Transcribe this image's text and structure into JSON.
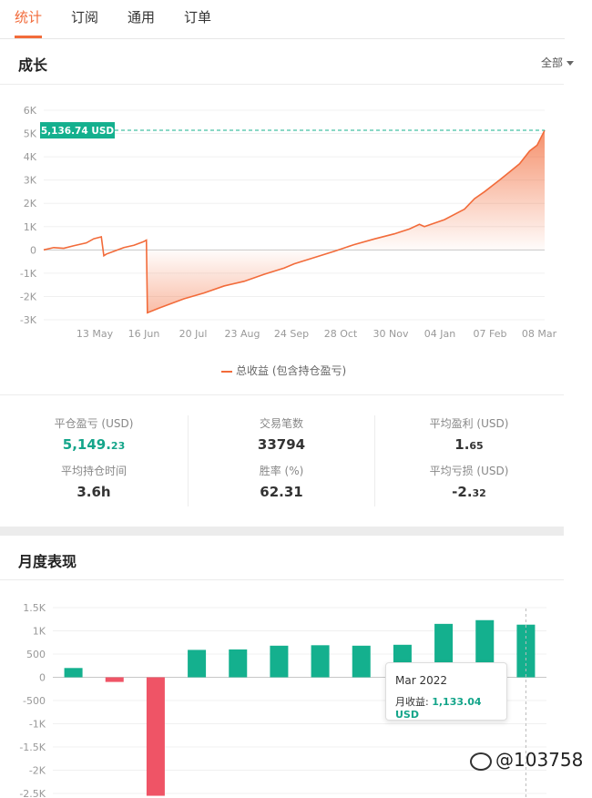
{
  "tabs": [
    {
      "label": "统计",
      "active": true
    },
    {
      "label": "订阅",
      "active": false
    },
    {
      "label": "通用",
      "active": false
    },
    {
      "label": "订单",
      "active": false
    }
  ],
  "growth": {
    "title": "成长",
    "filter": "全部",
    "current_value_label": "5,136.74 USD",
    "legend_label": "总收益 (包含持仓盈亏)"
  },
  "stats": {
    "closed_pnl_label": "平仓盈亏 (USD)",
    "closed_pnl_main": "5,149.",
    "closed_pnl_dec": "23",
    "trades_label": "交易笔数",
    "trades_value": "33794",
    "avg_profit_label": "平均盈利 (USD)",
    "avg_profit_main": "1.",
    "avg_profit_dec": "65",
    "avg_hold_label": "平均持仓时间",
    "avg_hold_value": "3.6h",
    "winrate_label": "胜率 (%)",
    "winrate_value": "62.31",
    "avg_loss_label": "平均亏损 (USD)",
    "avg_loss_main": "-2.",
    "avg_loss_dec": "32"
  },
  "monthly": {
    "title": "月度表现",
    "tooltip_month": "Mar 2022",
    "tooltip_label": "月收益:",
    "tooltip_value": "1,133.04 USD"
  },
  "watermark": "@103758",
  "colors": {
    "accent": "#f26b3a",
    "positive": "#14b08e",
    "negative": "#ef5466"
  },
  "chart_data": [
    {
      "type": "area",
      "title": "成长",
      "series": [
        {
          "name": "总收益 (包含持仓盈亏)"
        }
      ],
      "x_ticks": [
        "13 May",
        "16 Jun",
        "20 Jul",
        "23 Aug",
        "24 Sep",
        "28 Oct",
        "30 Nov",
        "04 Jan",
        "07 Feb",
        "08 Mar"
      ],
      "y_ticks": [
        "6K",
        "5K",
        "4K",
        "3K",
        "2K",
        "1K",
        "0",
        "-1K",
        "-2K",
        "-3K"
      ],
      "ylim": [
        -3000,
        6000
      ],
      "points": [
        [
          0.0,
          0
        ],
        [
          0.02,
          100
        ],
        [
          0.04,
          70
        ],
        [
          0.06,
          180
        ],
        [
          0.085,
          300
        ],
        [
          0.1,
          480
        ],
        [
          0.115,
          560
        ],
        [
          0.12,
          -250
        ],
        [
          0.125,
          -180
        ],
        [
          0.14,
          -60
        ],
        [
          0.16,
          100
        ],
        [
          0.18,
          200
        ],
        [
          0.2,
          360
        ],
        [
          0.205,
          420
        ],
        [
          0.207,
          -2700
        ],
        [
          0.23,
          -2500
        ],
        [
          0.28,
          -2100
        ],
        [
          0.32,
          -1850
        ],
        [
          0.36,
          -1550
        ],
        [
          0.4,
          -1350
        ],
        [
          0.44,
          -1050
        ],
        [
          0.48,
          -780
        ],
        [
          0.5,
          -600
        ],
        [
          0.54,
          -330
        ],
        [
          0.58,
          -60
        ],
        [
          0.62,
          230
        ],
        [
          0.66,
          470
        ],
        [
          0.7,
          690
        ],
        [
          0.73,
          900
        ],
        [
          0.75,
          1100
        ],
        [
          0.76,
          1000
        ],
        [
          0.8,
          1300
        ],
        [
          0.84,
          1750
        ],
        [
          0.86,
          2200
        ],
        [
          0.88,
          2500
        ],
        [
          0.91,
          3000
        ],
        [
          0.93,
          3350
        ],
        [
          0.95,
          3700
        ],
        [
          0.97,
          4250
        ],
        [
          0.985,
          4500
        ],
        [
          1.0,
          5136.74
        ]
      ],
      "y_units": "USD",
      "current_value": 5136.74,
      "grid": true
    },
    {
      "type": "bar",
      "title": "月度表现",
      "y_ticks": [
        "1.5K",
        "1K",
        "500",
        "0",
        "-500",
        "-1K",
        "-1.5K",
        "-2K",
        "-2.5K"
      ],
      "ylim": [
        -2500,
        1500
      ],
      "values": [
        200,
        -100,
        -2550,
        590,
        600,
        680,
        690,
        680,
        700,
        1150,
        1230,
        1133.04
      ],
      "grid": true
    }
  ]
}
